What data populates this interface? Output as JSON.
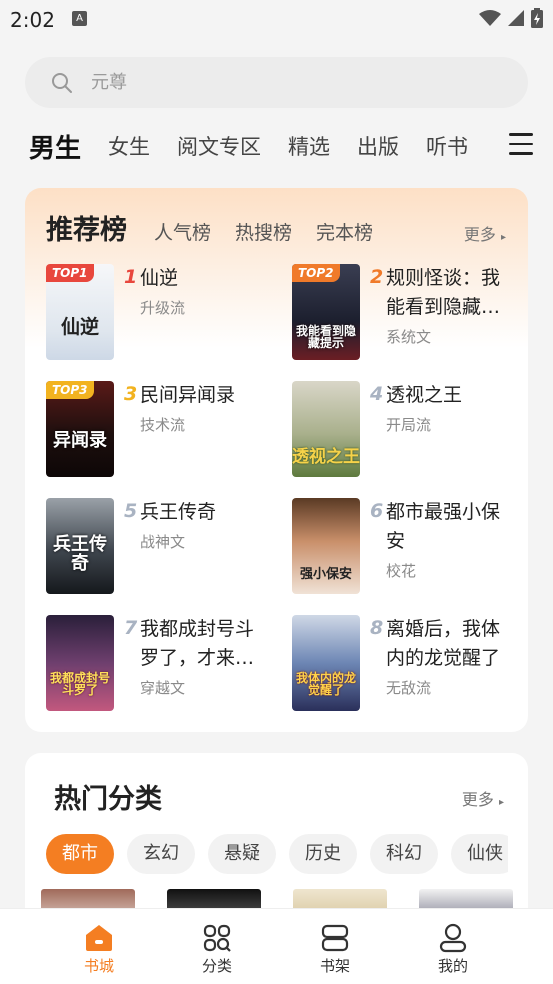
{
  "status": {
    "time": "2:02",
    "notif_letter": "A"
  },
  "search": {
    "placeholder": "元尊"
  },
  "tabs": [
    "男生",
    "女生",
    "阅文专区",
    "精选",
    "出版",
    "听书"
  ],
  "ranking": {
    "title": "推荐榜",
    "tabs": [
      "人气榜",
      "热搜榜",
      "完本榜"
    ],
    "more": "更多",
    "books": [
      {
        "rank": "1",
        "badge": "TOP1",
        "title": "仙逆",
        "tag": "升级流",
        "cover_text": "仙逆"
      },
      {
        "rank": "2",
        "badge": "TOP2",
        "title": "规则怪谈：我能看到隐藏…",
        "tag": "系统文",
        "cover_text": "我能看到隐藏提示"
      },
      {
        "rank": "3",
        "badge": "TOP3",
        "title": "民间异闻录",
        "tag": "技术流",
        "cover_text": "异闻录"
      },
      {
        "rank": "4",
        "badge": "",
        "title": "透视之王",
        "tag": "开局流",
        "cover_text": "透视之王"
      },
      {
        "rank": "5",
        "badge": "",
        "title": "兵王传奇",
        "tag": "战神文",
        "cover_text": "兵王传奇"
      },
      {
        "rank": "6",
        "badge": "",
        "title": "都市最强小保安",
        "tag": "校花",
        "cover_text": "强小保安"
      },
      {
        "rank": "7",
        "badge": "",
        "title": "我都成封号斗罗了，才来…",
        "tag": "穿越文",
        "cover_text": "我都成封号斗罗了"
      },
      {
        "rank": "8",
        "badge": "",
        "title": "离婚后，我体内的龙觉醒了",
        "tag": "无敌流",
        "cover_text": "我体内的龙觉醒了"
      }
    ]
  },
  "categories": {
    "title": "热门分类",
    "more": "更多",
    "chips": [
      "都市",
      "玄幻",
      "悬疑",
      "历史",
      "科幻",
      "仙侠"
    ]
  },
  "bottom_nav": [
    {
      "label": "书城",
      "icon": "home-icon"
    },
    {
      "label": "分类",
      "icon": "grid-icon"
    },
    {
      "label": "书架",
      "icon": "bookshelf-icon"
    },
    {
      "label": "我的",
      "icon": "profile-icon"
    }
  ],
  "colors": {
    "accent": "#f47e22",
    "top1": "#e8473d",
    "top2": "#f07a2a",
    "top3": "#f2b320",
    "rank_gray": "#a9b3c2"
  }
}
